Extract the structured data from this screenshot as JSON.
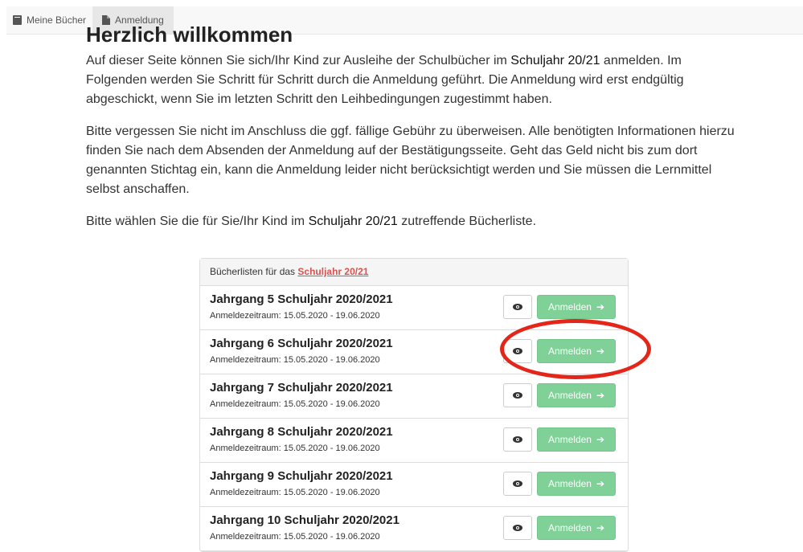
{
  "nav": {
    "items": [
      {
        "label": "Meine Bücher",
        "icon": "book-icon"
      },
      {
        "label": "Anmeldung",
        "icon": "file-icon"
      }
    ]
  },
  "main": {
    "heading": "Herzlich willkommen",
    "p1_a": "Auf dieser Seite können Sie sich/Ihr Kind zur Ausleihe der Schulbücher im ",
    "p1_b": "Schuljahr 20/21",
    "p1_c": " anmelden. Im Folgenden werden Sie Schritt für Schritt durch die Anmeldung geführt. Die Anmeldung wird erst endgültig abgeschickt, wenn Sie im letzten Schritt den Leihbedingungen zugestimmt haben.",
    "p2": "Bitte vergessen Sie nicht im Anschluss die ggf. fällige Gebühr zu überweisen. Alle benötigten Informationen hierzu finden Sie nach dem Absenden der Anmeldung auf der Bestätigungsseite. Geht das Geld nicht bis zum dort genannten Stichtag ein, kann die Anmeldung leider nicht berücksichtigt werden und Sie müssen die Lernmittel selbst anschaffen.",
    "p3_a": "Bitte wählen Sie die für Sie/Ihr Kind im ",
    "p3_b": "Schuljahr 20/21",
    "p3_c": " zutreffende Bücherliste."
  },
  "panel": {
    "heading_prefix": "Bücherlisten für das ",
    "heading_link": "Schuljahr 20/21",
    "register_label": "Anmelden",
    "rows": [
      {
        "title": "Jahrgang 5 Schuljahr 2020/2021",
        "period": "Anmeldezeitraum: 15.05.2020 - 19.06.2020"
      },
      {
        "title": "Jahrgang 6 Schuljahr 2020/2021",
        "period": "Anmeldezeitraum: 15.05.2020 - 19.06.2020"
      },
      {
        "title": "Jahrgang 7 Schuljahr 2020/2021",
        "period": "Anmeldezeitraum: 15.05.2020 - 19.06.2020"
      },
      {
        "title": "Jahrgang 8 Schuljahr 2020/2021",
        "period": "Anmeldezeitraum: 15.05.2020 - 19.06.2020"
      },
      {
        "title": "Jahrgang 9 Schuljahr 2020/2021",
        "period": "Anmeldezeitraum: 15.05.2020 - 19.06.2020"
      },
      {
        "title": "Jahrgang 10 Schuljahr 2020/2021",
        "period": "Anmeldezeitraum: 15.05.2020 - 19.06.2020"
      }
    ]
  },
  "colors": {
    "accent_green": "#7fd198",
    "link_red": "#d9534f",
    "highlight_circle": "#e32619"
  }
}
